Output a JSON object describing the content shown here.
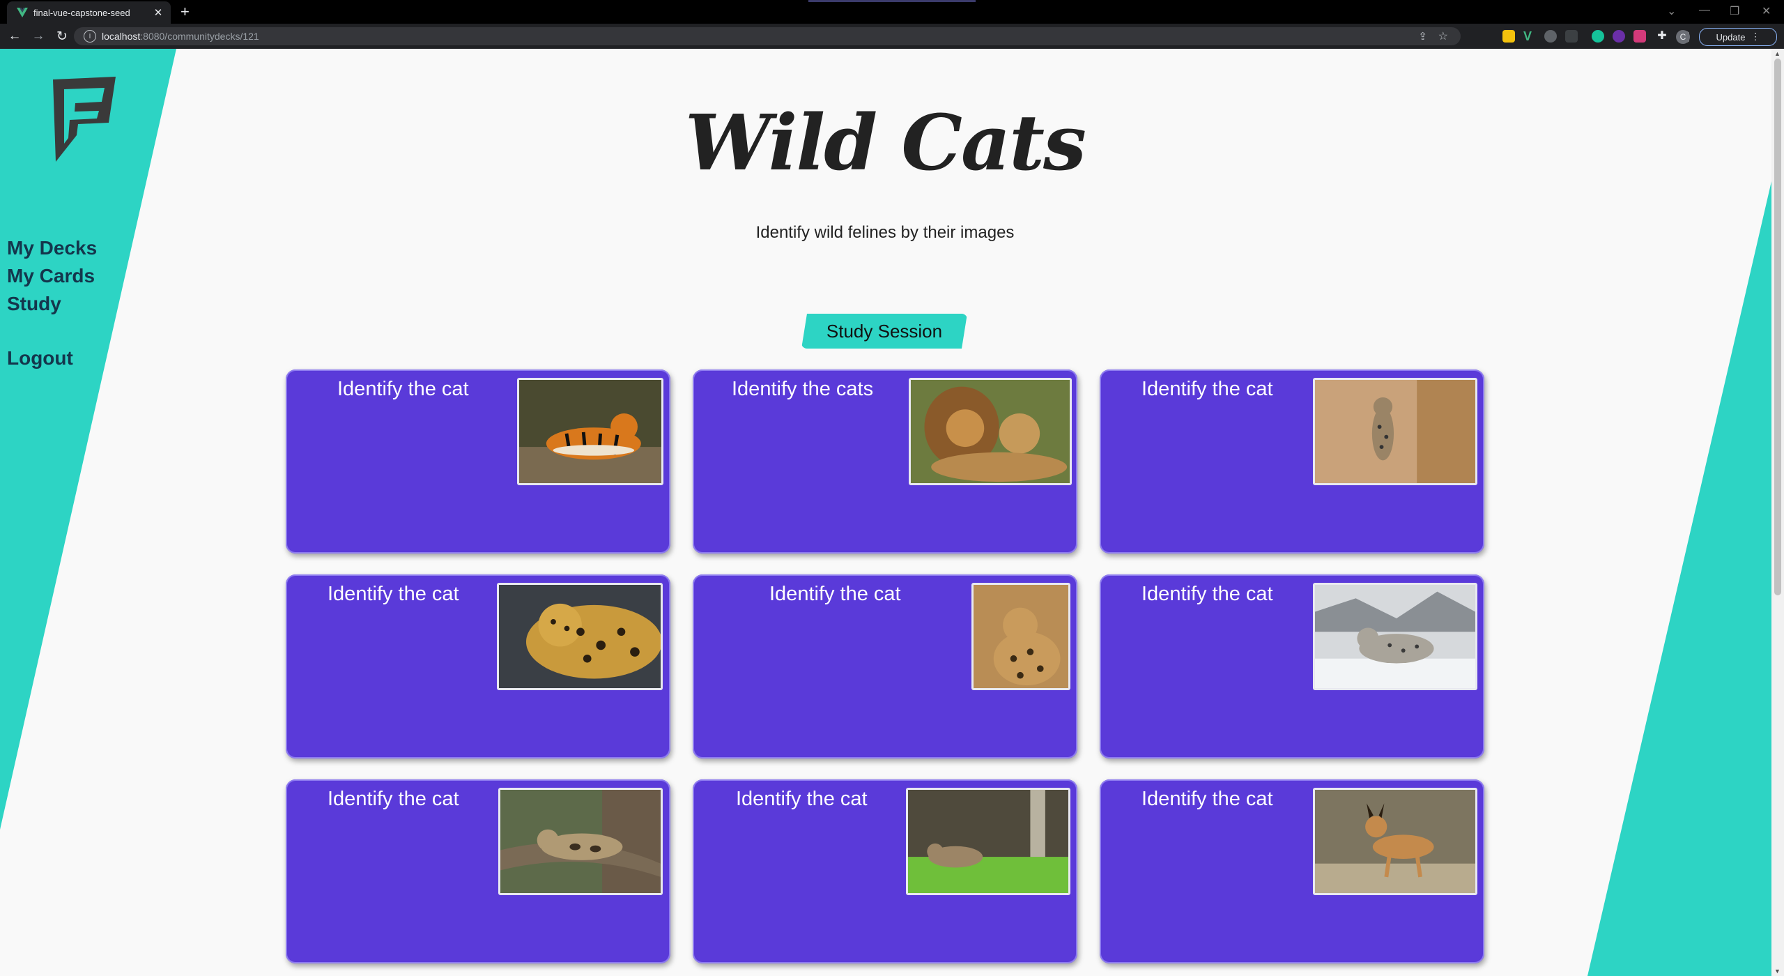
{
  "browser": {
    "tab_title": "final-vue-capstone-seed",
    "url_host": "localhost",
    "url_path": ":8080/communitydecks/121",
    "update_label": "Update"
  },
  "sidebar": {
    "items": [
      {
        "label": "My Decks"
      },
      {
        "label": "My Cards"
      },
      {
        "label": "Study"
      },
      {
        "label": "Logout"
      }
    ]
  },
  "deck": {
    "title": "Wild Cats",
    "description": "Identify wild felines by their images",
    "study_button": "Study Session"
  },
  "cards": [
    {
      "question": "Identify the cat",
      "image": "tiger-photo"
    },
    {
      "question": "Identify the cats",
      "image": "lions-photo"
    },
    {
      "question": "Identify the cat",
      "image": "leopard-photo"
    },
    {
      "question": "Identify the cat",
      "image": "jaguar-photo"
    },
    {
      "question": "Identify the cat",
      "image": "serval-photo"
    },
    {
      "question": "Identify the cat",
      "image": "snow-leopard-photo"
    },
    {
      "question": "Identify the cat",
      "image": "clouded-leopard-photo"
    },
    {
      "question": "Identify the cat",
      "image": "ocelot-photo"
    },
    {
      "question": "Identify the cat",
      "image": "caracal-photo"
    }
  ],
  "colors": {
    "accent_teal": "#2dd4c4",
    "card_purple": "#5a3ad9",
    "nav_text": "#14364c"
  }
}
